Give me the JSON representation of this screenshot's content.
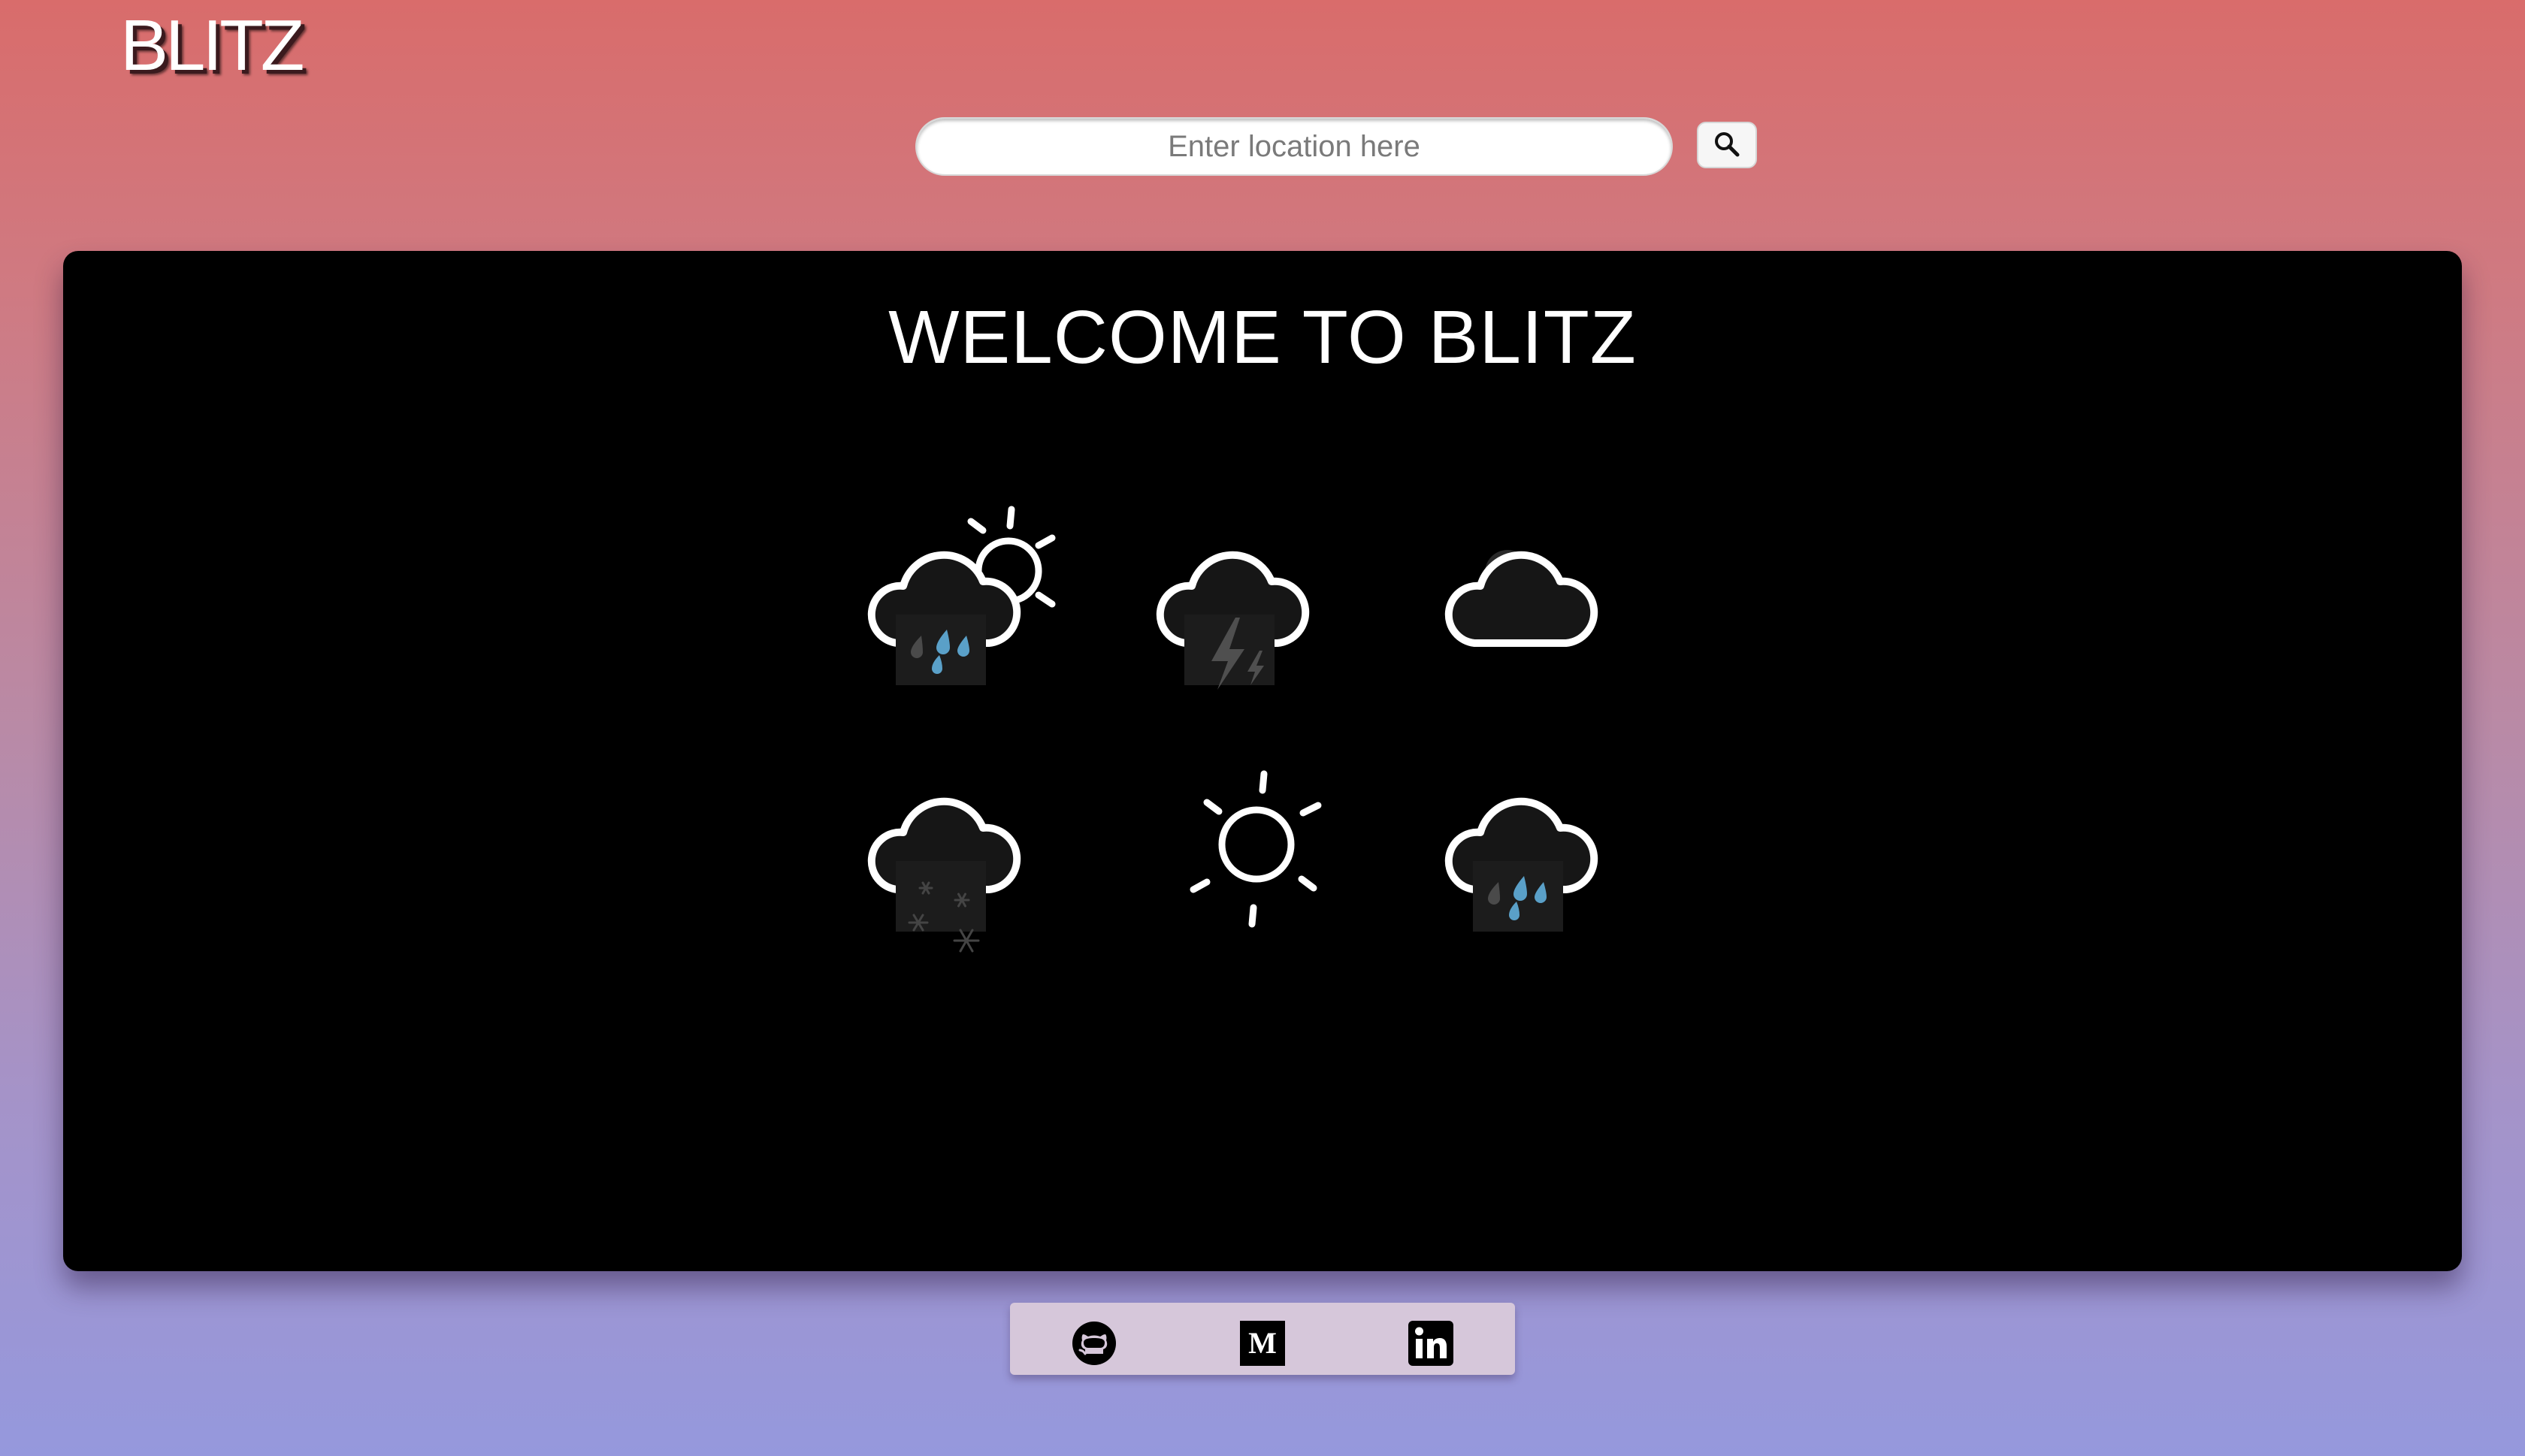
{
  "header": {
    "logo": "BLITZ"
  },
  "search": {
    "placeholder": "Enter location here",
    "value": "",
    "button_icon": "search-icon"
  },
  "main": {
    "heading": "WELCOME TO BLITZ",
    "weather_icons": [
      {
        "icon": "partly-sunny-rain-icon"
      },
      {
        "icon": "thunderstorm-icon"
      },
      {
        "icon": "cloudy-icon"
      },
      {
        "icon": "snow-icon"
      },
      {
        "icon": "sunny-icon"
      },
      {
        "icon": "rain-icon"
      }
    ]
  },
  "footer": {
    "links": [
      {
        "icon": "github-icon"
      },
      {
        "icon": "medium-icon"
      },
      {
        "icon": "linkedin-icon"
      }
    ]
  },
  "colors": {
    "background_top": "#d96c6b",
    "background_bottom": "#9598dd",
    "panel": "#000000",
    "footer_bar": "#d6c7da",
    "rain_drop": "#5aa0c8"
  }
}
